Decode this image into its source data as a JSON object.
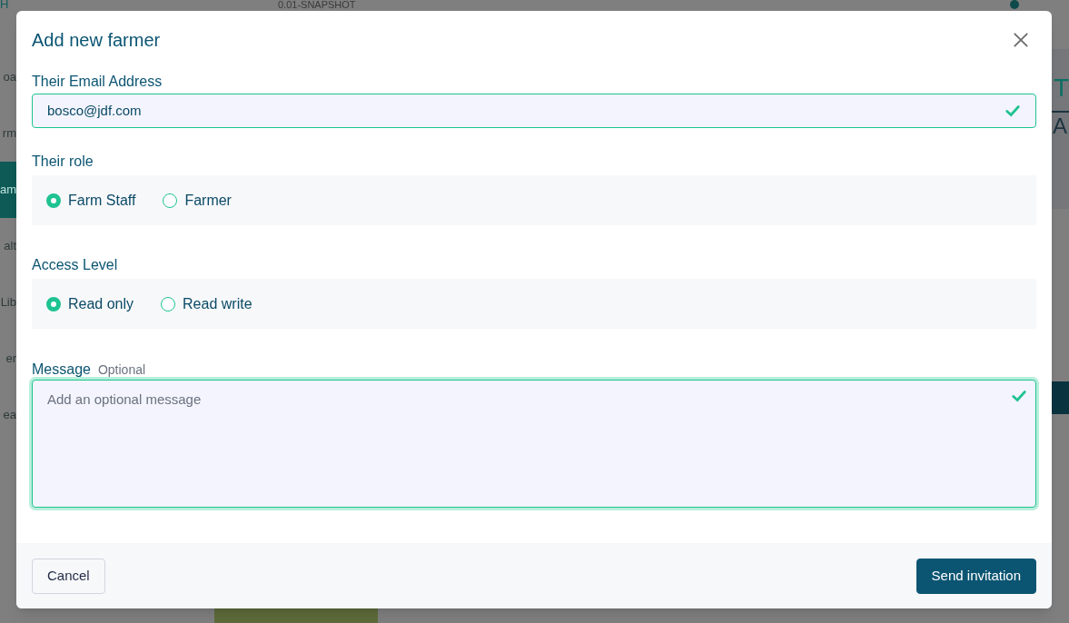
{
  "background": {
    "logo_fragment": "H",
    "version": "0.01-SNAPSHOT",
    "sidebar_fragments": [
      {
        "label": "oa",
        "selected": false
      },
      {
        "label": "rm",
        "selected": false
      },
      {
        "label": "am",
        "selected": true
      },
      {
        "label": "alt",
        "selected": false
      },
      {
        "label": "Lib",
        "selected": false
      },
      {
        "label": "er",
        "selected": false
      },
      {
        "label": "ea",
        "selected": false
      }
    ],
    "right_fragments": [
      {
        "label": "T",
        "kind": "heading"
      },
      {
        "label": "A",
        "kind": "tab"
      }
    ]
  },
  "dialog": {
    "title": "Add new farmer",
    "email": {
      "label": "Their Email Address",
      "value": "bosco@jdf.com",
      "valid": true
    },
    "groups": [
      {
        "label": "Their role",
        "options": [
          {
            "label": "Farm Staff",
            "selected": true
          },
          {
            "label": "Farmer",
            "selected": false
          }
        ]
      },
      {
        "label": "Access Level",
        "options": [
          {
            "label": "Read only",
            "selected": true
          },
          {
            "label": "Read write",
            "selected": false
          }
        ]
      }
    ],
    "message": {
      "label": "Message",
      "hint": "Optional",
      "placeholder": "Add an optional message",
      "valid": true
    },
    "buttons": [
      {
        "label": "Cancel",
        "kind": "secondary"
      },
      {
        "label": "Send invitation",
        "kind": "primary"
      }
    ]
  }
}
